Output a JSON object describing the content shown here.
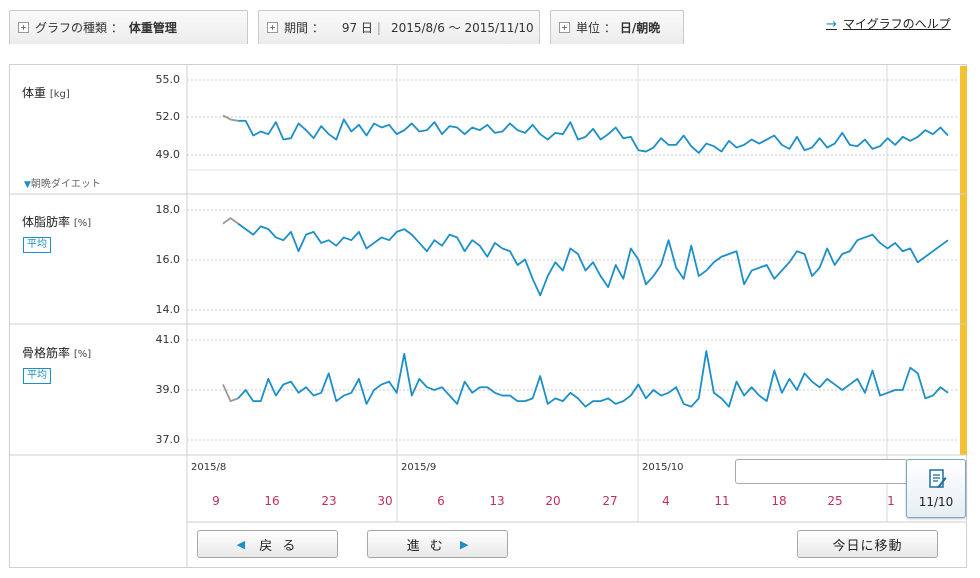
{
  "header": {
    "graph_type_label": "グラフの種類 ：",
    "graph_type_value": "体重管理",
    "period_label": "期間 ：",
    "period_days": "97 日",
    "period_range": "2015/8/6 〜 2015/11/10",
    "unit_label": "単位 ：",
    "unit_value": "日/朝晩",
    "help_link": "マイグラフのヘルプ"
  },
  "panels": [
    {
      "title": "体重",
      "unit": "[kg]",
      "diet_label": "朝晩ダイエット",
      "ticks": [
        "55.0",
        "52.0",
        "49.0"
      ]
    },
    {
      "title": "体脂肪率",
      "unit": "[%]",
      "badge": "平均",
      "ticks": [
        "18.0",
        "16.0",
        "14.0"
      ]
    },
    {
      "title": "骨格筋率",
      "unit": "[%]",
      "badge": "平均",
      "ticks": [
        "41.0",
        "39.0",
        "37.0"
      ]
    }
  ],
  "timeline": {
    "months": [
      "2015/8",
      "2015/9",
      "2015/10"
    ],
    "days": [
      "9",
      "16",
      "23",
      "30",
      "6",
      "13",
      "20",
      "27",
      "4",
      "11",
      "18",
      "25",
      "1"
    ]
  },
  "buttons": {
    "back": "戻 る",
    "forward": "進 む",
    "today": "今日に移動"
  },
  "memo": {
    "date": "11/10"
  },
  "colors": {
    "line": "#1c8fc8",
    "line_prev": "#999999",
    "accent_yellow": "#f3c234",
    "day_text": "#c0305e"
  },
  "chart_data": [
    {
      "type": "line",
      "title": "体重",
      "ylabel": "[kg]",
      "ylim": [
        47.0,
        56.5
      ],
      "start_date": "2015-08-06",
      "series": [
        {
          "values": [
            52.8,
            52.5,
            52.4,
            52.4,
            51.3,
            51.6,
            51.4,
            52.3,
            51.0,
            51.1,
            52.2,
            51.7,
            51.1,
            52.0,
            51.4,
            51.0,
            52.5,
            51.6,
            52.1,
            51.3,
            52.2,
            51.9,
            52.1,
            51.4,
            51.7,
            52.2,
            51.6,
            51.7,
            52.3,
            51.4,
            52.0,
            51.9,
            51.4,
            51.9,
            51.7,
            52.1,
            51.5,
            51.6,
            52.2,
            51.7,
            51.5,
            52.1,
            51.4,
            51.0,
            51.5,
            51.4,
            52.3,
            51.0,
            51.2,
            51.8,
            51.0,
            51.4,
            51.9,
            51.1,
            51.2,
            50.2,
            50.1,
            50.4,
            51.1,
            50.6,
            50.6,
            51.3,
            50.5,
            50.0,
            50.7,
            50.5,
            50.1,
            50.9,
            50.4,
            50.6,
            51.0,
            50.7,
            51.0,
            51.3,
            50.6,
            50.3,
            51.2,
            50.2,
            50.4,
            51.1,
            50.4,
            50.7,
            51.5,
            50.6,
            50.5,
            51.0,
            50.3,
            50.5,
            51.1,
            50.6,
            51.2,
            50.9,
            51.2,
            51.7,
            51.4,
            51.9,
            51.3
          ]
        }
      ]
    },
    {
      "type": "line",
      "title": "体脂肪率",
      "ylabel": "[%]",
      "ylim": [
        13.6,
        18.2
      ],
      "start_date": "2015-08-06",
      "series": [
        {
          "values": [
            17.2,
            17.4,
            17.2,
            17.0,
            16.8,
            17.1,
            17.0,
            16.7,
            16.6,
            16.9,
            16.2,
            16.8,
            16.9,
            16.5,
            16.6,
            16.4,
            16.7,
            16.6,
            16.9,
            16.3,
            16.5,
            16.7,
            16.6,
            16.9,
            17.0,
            16.8,
            16.5,
            16.2,
            16.6,
            16.4,
            16.8,
            16.7,
            16.2,
            16.6,
            16.4,
            16.0,
            16.5,
            16.3,
            16.2,
            15.7,
            15.9,
            15.2,
            14.6,
            15.3,
            15.8,
            15.5,
            16.3,
            16.1,
            15.5,
            15.8,
            15.3,
            14.9,
            15.7,
            15.2,
            16.3,
            15.9,
            15.0,
            15.3,
            15.7,
            16.6,
            15.6,
            15.2,
            16.4,
            15.3,
            15.5,
            15.8,
            16.0,
            16.1,
            16.2,
            15.0,
            15.5,
            15.6,
            15.7,
            15.2,
            15.5,
            15.8,
            16.2,
            16.1,
            15.3,
            15.6,
            16.3,
            15.7,
            16.1,
            16.2,
            16.6,
            16.7,
            16.8,
            16.5,
            16.3,
            16.5,
            16.2,
            16.3,
            15.8,
            16.0,
            16.2,
            16.4,
            16.6
          ]
        }
      ]
    },
    {
      "type": "line",
      "title": "骨格筋率",
      "ylabel": "[%]",
      "ylim": [
        36.7,
        41.3
      ],
      "start_date": "2015-08-06",
      "series": [
        {
          "values": [
            39.2,
            38.6,
            38.7,
            39.0,
            38.6,
            38.6,
            39.4,
            38.8,
            39.2,
            39.3,
            38.9,
            39.1,
            38.8,
            38.9,
            39.6,
            38.6,
            38.8,
            38.9,
            39.4,
            38.5,
            39.0,
            39.2,
            39.3,
            38.9,
            40.3,
            38.8,
            39.4,
            39.1,
            39.0,
            39.1,
            38.8,
            38.5,
            39.3,
            38.9,
            39.1,
            39.1,
            38.9,
            38.8,
            38.8,
            38.6,
            38.6,
            38.7,
            39.5,
            38.5,
            38.7,
            38.6,
            38.9,
            38.7,
            38.4,
            38.6,
            38.6,
            38.7,
            38.5,
            38.6,
            38.8,
            39.2,
            38.7,
            39.0,
            38.8,
            38.9,
            39.1,
            38.5,
            38.4,
            38.7,
            40.4,
            38.9,
            38.7,
            38.4,
            39.3,
            38.8,
            39.1,
            38.8,
            38.6,
            39.7,
            38.9,
            39.4,
            39.0,
            39.6,
            39.3,
            39.1,
            39.4,
            39.2,
            39.0,
            39.2,
            39.4,
            38.9,
            39.7,
            38.8,
            38.9,
            39.0,
            39.0,
            39.8,
            39.6,
            38.7,
            38.8,
            39.1,
            38.9
          ]
        }
      ]
    }
  ]
}
